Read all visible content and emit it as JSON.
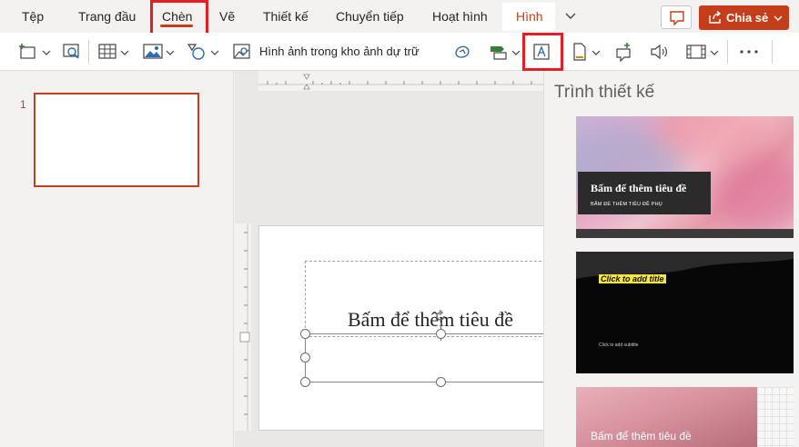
{
  "tabs": [
    {
      "id": "tep",
      "label": "Tệp"
    },
    {
      "id": "trangdau",
      "label": "Trang đầu"
    },
    {
      "id": "chen",
      "label": "Chèn"
    },
    {
      "id": "ve",
      "label": "Vẽ"
    },
    {
      "id": "thietke",
      "label": "Thiết kế"
    },
    {
      "id": "chuyentiep",
      "label": "Chuyển tiếp"
    },
    {
      "id": "hoathinh",
      "label": "Hoạt hình"
    },
    {
      "id": "hinh",
      "label": "Hình"
    }
  ],
  "active_tab": "Chèn",
  "share_label": "Chia sẻ",
  "ribbon": {
    "stock_images_label": "Hình ảnh trong kho ảnh dự trữ"
  },
  "thumbnails": {
    "slide_number": "1"
  },
  "slide": {
    "title_placeholder": "Bấm để thêm tiêu đề"
  },
  "designer": {
    "title": "Trình thiết kế",
    "designs": [
      {
        "title": "Bấm để thêm tiêu đề",
        "subtitle": "BẤM ĐỂ THÊM TIÊU ĐỀ PHỤ"
      },
      {
        "title": "Click to add title",
        "subtitle": "Click to add subtitle"
      },
      {
        "title": "Bấm để thêm tiêu đề"
      }
    ]
  },
  "colors": {
    "accent": "#c43e1c",
    "highlight_box": "#e31e24",
    "ribbon_bg": "#ffffff",
    "chrome_bg": "#f3f2f1"
  }
}
